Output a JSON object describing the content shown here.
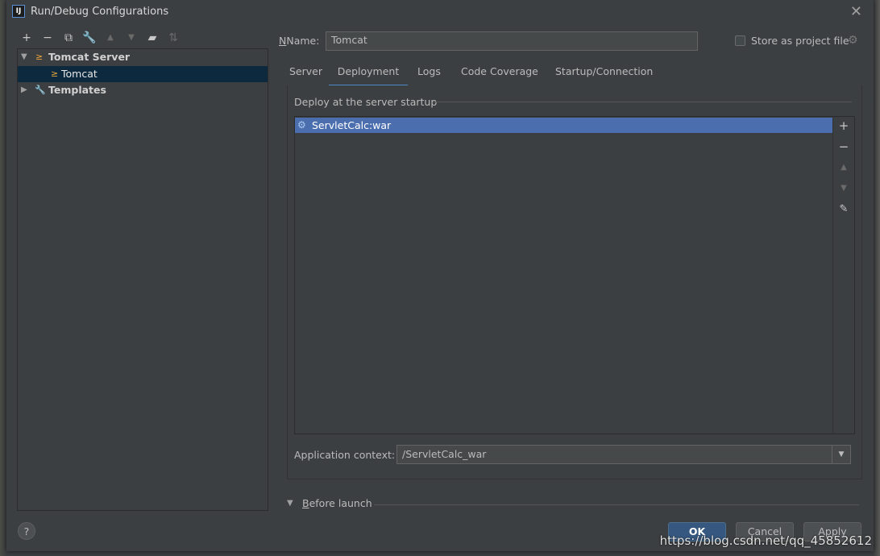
{
  "window": {
    "title": "Run/Debug Configurations",
    "app_icon": "IJ"
  },
  "toolbar": {
    "icons": [
      "add-icon",
      "remove-icon",
      "copy-icon",
      "wrench-icon",
      "move-up-icon",
      "move-down-icon",
      "new-folder-icon",
      "sort-icon"
    ]
  },
  "tree": {
    "items": [
      {
        "label": "Tomcat Server",
        "expanded": true
      },
      {
        "label": "Tomcat",
        "selected": true
      },
      {
        "label": "Templates",
        "expanded": false
      }
    ]
  },
  "form": {
    "name_label": "Name:",
    "name_value": "Tomcat",
    "store_label": "Store as project file",
    "tabs": [
      "Server",
      "Deployment",
      "Logs",
      "Code Coverage",
      "Startup/Connection"
    ],
    "active_tab": "Deployment",
    "deploy_title": "Deploy at the server startup",
    "artifacts": [
      "ServletCalc:war"
    ],
    "context_label": "Application context:",
    "context_value": "/ServletCalc_war",
    "before_launch": "Before launch"
  },
  "buttons": {
    "ok": "OK",
    "cancel": "Cancel",
    "apply": "Apply",
    "help": "?"
  },
  "watermark": "https://blog.csdn.net/qq_45852612",
  "colors": {
    "selection": "#4b6eaf",
    "tab_underline": "#4a88c7",
    "ok_button": "#365880"
  }
}
